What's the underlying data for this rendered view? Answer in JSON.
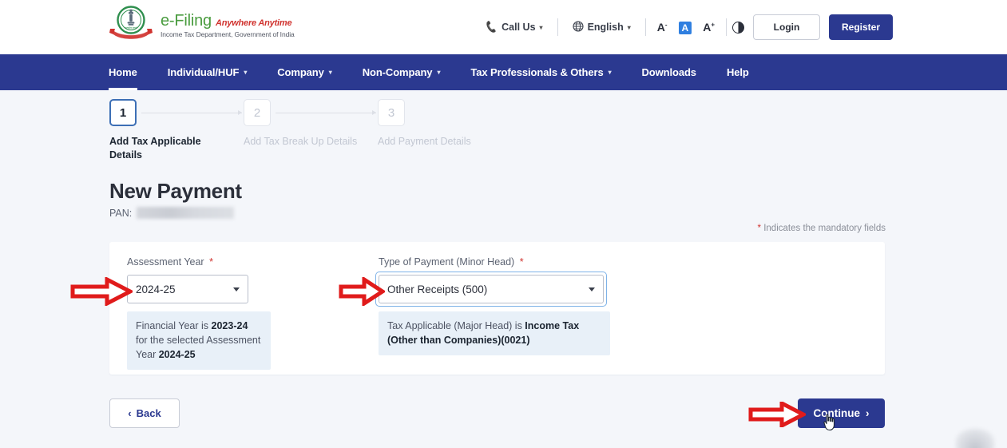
{
  "header": {
    "brand": {
      "efiling": "e-Filing",
      "tagline": "Anywhere Anytime",
      "department": "Income Tax Department, Government of India",
      "logo_icon": "income-tax-emblem-icon"
    },
    "call_us": "Call Us",
    "language": "English",
    "font_decrease": "A",
    "font_normal": "A",
    "font_increase": "A",
    "contrast_icon": "contrast-toggle-icon",
    "login": "Login",
    "register": "Register"
  },
  "nav": {
    "items": [
      {
        "label": "Home",
        "has_caret": false,
        "active": true
      },
      {
        "label": "Individual/HUF",
        "has_caret": true,
        "active": false
      },
      {
        "label": "Company",
        "has_caret": true,
        "active": false
      },
      {
        "label": "Non-Company",
        "has_caret": true,
        "active": false
      },
      {
        "label": "Tax Professionals & Others",
        "has_caret": true,
        "active": false
      },
      {
        "label": "Downloads",
        "has_caret": false,
        "active": false
      },
      {
        "label": "Help",
        "has_caret": false,
        "active": false
      }
    ]
  },
  "stepper": {
    "steps": [
      {
        "number": "1",
        "label": "Add Tax Applicable Details",
        "state": "active"
      },
      {
        "number": "2",
        "label": "Add Tax Break Up Details",
        "state": "inactive"
      },
      {
        "number": "3",
        "label": "Add Payment Details",
        "state": "inactive"
      }
    ]
  },
  "page": {
    "title": "New Payment",
    "pan_label": "PAN:",
    "pan_value": "",
    "mandatory_note": "Indicates the mandatory fields",
    "mandatory_asterisk": "*"
  },
  "form": {
    "assessment_year": {
      "label": "Assessment Year",
      "required_marker": "*",
      "value": "2024-25",
      "info_prefix": "Financial Year is ",
      "info_fy": "2023-24",
      "info_middle": " for the selected Assessment Year ",
      "info_ay": "2024-25"
    },
    "type_of_payment": {
      "label": "Type of Payment (Minor Head)",
      "required_marker": "*",
      "value": "Other Receipts (500)",
      "focused": true,
      "info_prefix": "Tax Applicable (Major Head) is ",
      "info_bold": "Income Tax (Other than Companies)(0021)"
    }
  },
  "footer": {
    "back": "Back",
    "back_icon": "chevron-left-icon",
    "continue": "Continue",
    "continue_icon": "chevron-right-icon"
  },
  "annotations": {
    "arrow_assessment_year": "red-arrow-right-icon",
    "arrow_type_of_payment": "red-arrow-right-icon",
    "arrow_continue": "red-arrow-right-icon",
    "cursor": "pointer-hand-cursor-icon"
  },
  "colors": {
    "brand_navy": "#2b3990",
    "brand_green": "#4a9c3f",
    "brand_red": "#d0332f",
    "accent_blue": "#2f7fe0",
    "info_bg": "#e8f0f8",
    "page_bg": "#f4f6fa",
    "annotation_red": "#e01b1b"
  }
}
